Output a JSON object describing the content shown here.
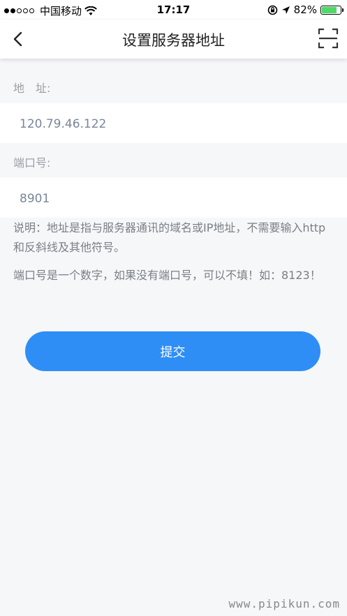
{
  "status_bar": {
    "carrier": "中国移动",
    "time": "17:17",
    "battery_percent_label": "82%",
    "battery_level": 0.82,
    "signal_bars_filled": 2,
    "signal_bars_total": 5
  },
  "nav": {
    "title": "设置服务器地址",
    "back_icon": "chevron-left-icon",
    "scan_icon": "scan-icon"
  },
  "form": {
    "address_label": "地　址:",
    "address_value": "120.79.46.122",
    "port_label": "端口号:",
    "port_value": "8901"
  },
  "notes": {
    "line1": "说明：地址是指与服务器通讯的域名或IP地址，不需要输入http和反斜线及其他符号。",
    "line2": "端口号是一个数字，如果没有端口号，可以不填！如：8123！"
  },
  "submit_label": "提交",
  "watermark": "www.pipikun.com",
  "colors": {
    "accent": "#2e8ef5",
    "background": "#f6f7f9",
    "battery": "#4cd964"
  }
}
